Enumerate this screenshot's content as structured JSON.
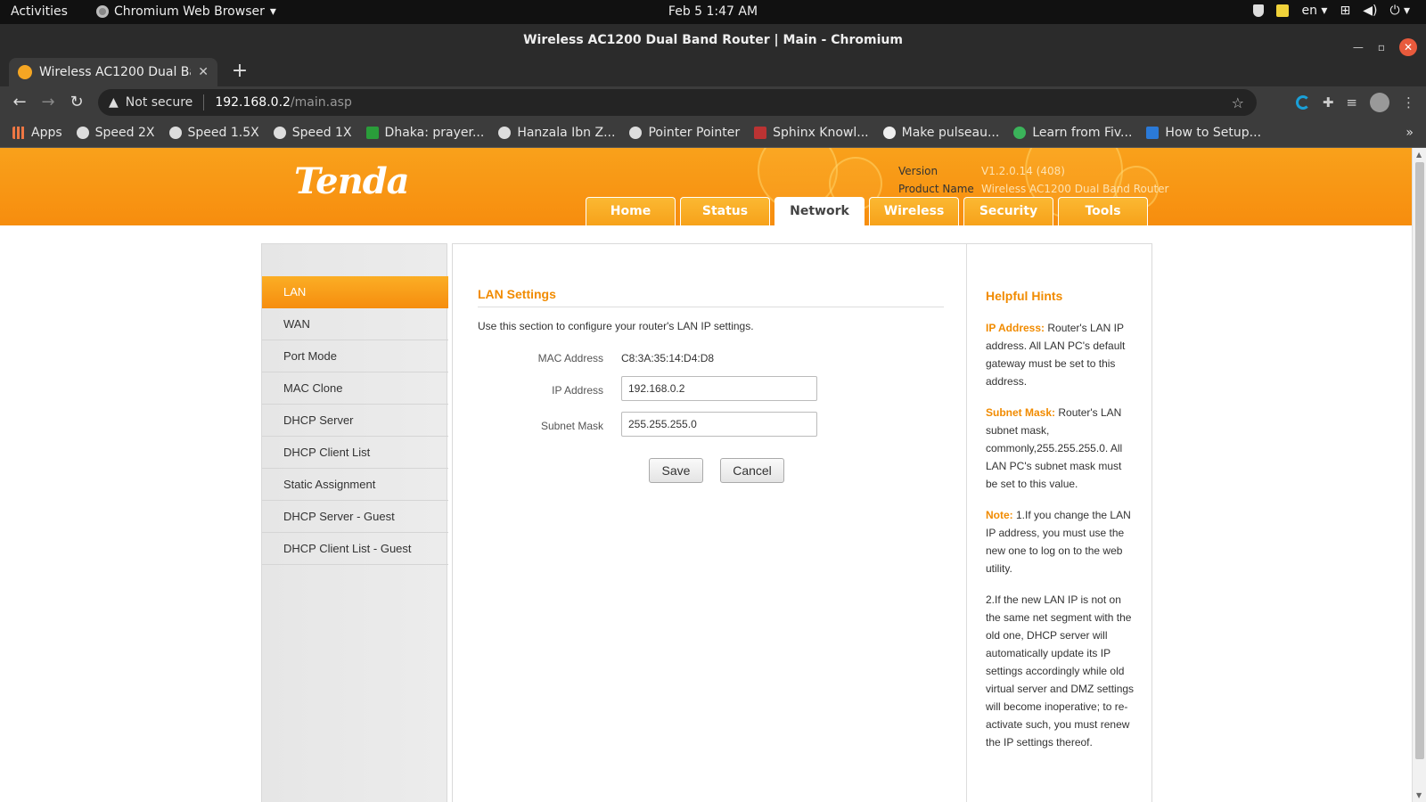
{
  "system_bar": {
    "activities": "Activities",
    "app_name": "Chromium Web Browser",
    "clock": "Feb 5  1:47 AM",
    "lang": "en"
  },
  "window": {
    "title": "Wireless AC1200 Dual Band Router | Main - Chromium"
  },
  "tab": {
    "title": "Wireless AC1200 Dual Band Router"
  },
  "omnibox": {
    "security": "Not secure",
    "host": "192.168.0.2",
    "path": "/main.asp"
  },
  "bookmarks": [
    {
      "label": "Apps",
      "icon": "apps-grid-icon"
    },
    {
      "label": "Speed 2X",
      "icon": "globe-icon"
    },
    {
      "label": "Speed 1.5X",
      "icon": "globe-icon"
    },
    {
      "label": "Speed 1X",
      "icon": "globe-icon"
    },
    {
      "label": "Dhaka: prayer...",
      "icon": "calendar-icon"
    },
    {
      "label": "Hanzala Ibn Z...",
      "icon": "site-icon"
    },
    {
      "label": "Pointer Pointer",
      "icon": "globe-icon"
    },
    {
      "label": "Sphinx Knowl...",
      "icon": "sphinx-icon"
    },
    {
      "label": "Make pulseau...",
      "icon": "github-icon"
    },
    {
      "label": "Learn from Fiv...",
      "icon": "fiverr-icon"
    },
    {
      "label": "How to Setup...",
      "icon": "site-icon"
    }
  ],
  "router": {
    "logo": "Tenda",
    "version_label": "Version",
    "version_value": "V1.2.0.14 (408)",
    "product_label": "Product Name",
    "product_value": "Wireless AC1200 Dual Band Router",
    "nav": [
      "Home",
      "Status",
      "Network",
      "Wireless",
      "Security",
      "Tools"
    ],
    "active_nav": "Network",
    "sidebar": [
      "LAN",
      "WAN",
      "Port Mode",
      "MAC Clone",
      "DHCP Server",
      "DHCP Client List",
      "Static Assignment",
      "DHCP Server - Guest",
      "DHCP Client List - Guest"
    ],
    "active_sidebar": "LAN",
    "section_title": "LAN Settings",
    "section_desc": "Use this section to configure your router's LAN IP settings.",
    "mac_label": "MAC Address",
    "mac_value": "C8:3A:35:14:D4:D8",
    "ip_label": "IP Address",
    "ip_value": "192.168.0.2",
    "mask_label": "Subnet Mask",
    "mask_value": "255.255.255.0",
    "save": "Save",
    "cancel": "Cancel",
    "hints_title": "Helpful Hints",
    "hint_ip_key": "IP Address:",
    "hint_ip_text": " Router's LAN IP address. All LAN PC's default gateway must be set to this address.",
    "hint_mask_key": "Subnet Mask:",
    "hint_mask_text": " Router's LAN subnet mask, commonly,255.255.255.0. All LAN PC's subnet mask must be set to this value.",
    "hint_note_key": "Note:",
    "hint_note_text": " 1.If you change the LAN IP address, you must use the new one to log on to the web utility.",
    "hint_note2": "2.If the new LAN IP is not on the same net segment with the old one, DHCP server will automatically update its IP settings accordingly while old virtual server and DMZ settings will become inoperative; to re-activate such, you must renew the IP settings thereof."
  }
}
